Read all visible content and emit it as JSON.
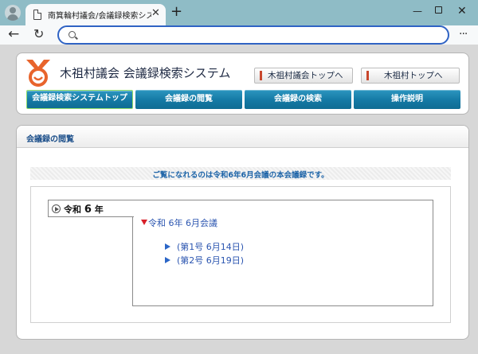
{
  "browser": {
    "tab_title": "南箕輪村議会/会議録検索システム",
    "tab_close": "✕",
    "new_tab": "+",
    "win_min": "—",
    "win_close": "✕",
    "back": "←",
    "reload": "↻",
    "address_value": "",
    "menu": "···"
  },
  "header": {
    "site_title": "木祖村議会 会議録検索システム",
    "top_buttons": [
      {
        "label": "木祖村議会トップへ"
      },
      {
        "label": "木祖村トップへ"
      }
    ],
    "nav": [
      {
        "label": "会議録検索システムトップ"
      },
      {
        "label": "会議録の閲覧"
      },
      {
        "label": "会議録の検索"
      },
      {
        "label": "操作説明"
      }
    ]
  },
  "content": {
    "panel_title": "会議録の閲覧",
    "notice": "ご覧になれるのは令和6年6月会議の本会議録です。",
    "year": {
      "era": "令和",
      "num": "6",
      "unit": "年"
    },
    "meeting": "令和 6年 6月会議",
    "sessions": [
      {
        "label": "(第1号 6月14日)"
      },
      {
        "label": "(第2号 6月19日)"
      }
    ]
  },
  "colors": {
    "nav_blue": "#1479a4",
    "notice_blue": "#1d64a8",
    "link_blue": "#2b55b0",
    "logo_orange": "#e8642c"
  }
}
